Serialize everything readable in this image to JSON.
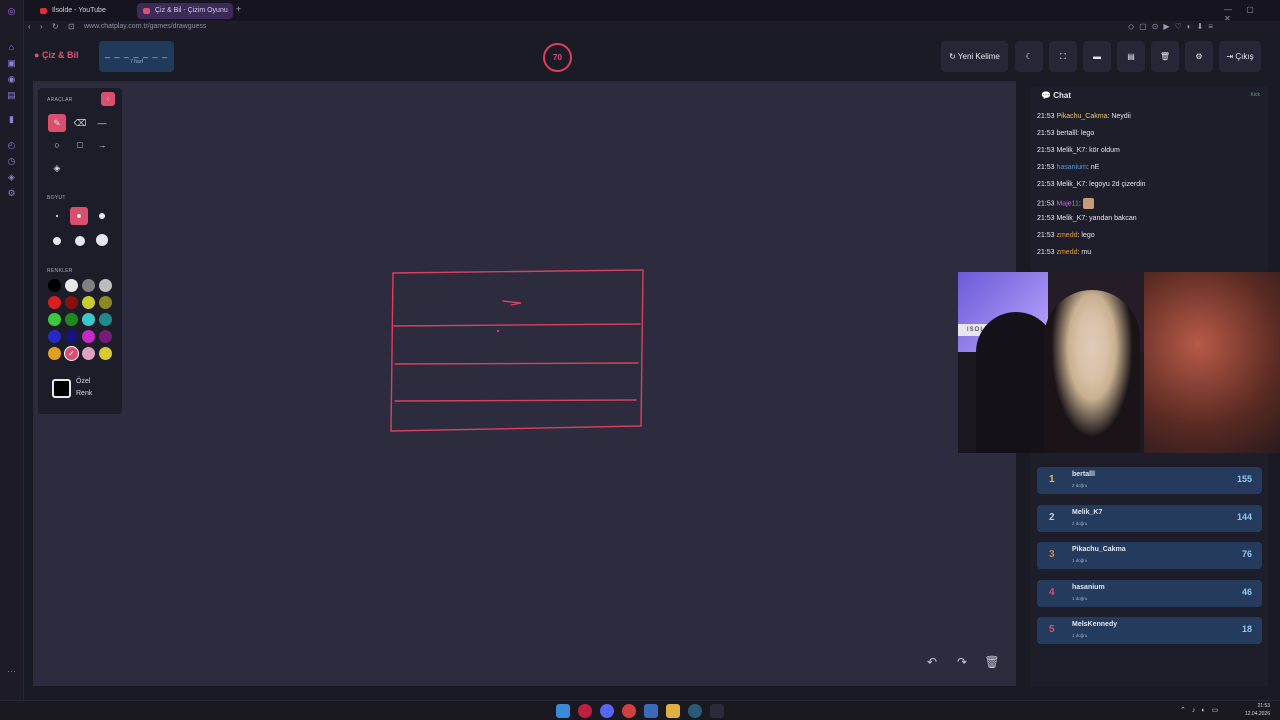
{
  "browser": {
    "tabs": [
      {
        "label": "Ilsolde - YouTube",
        "active": false
      },
      {
        "label": "Çiz & Bil - Çizim Oyunu",
        "active": true
      }
    ],
    "new_tab": "+",
    "url": "www.chatplay.com.tr/games/drawguess"
  },
  "header": {
    "logo": "Çiz & Bil",
    "word_mask": "_ _ _ _ _ _ _",
    "word_length": "7 harf",
    "timer": "70",
    "buttons": {
      "new_word": "Yeni Kelime",
      "exit": "Çıkış"
    }
  },
  "tools": {
    "section_tools": "ARAÇLAR",
    "section_size": "BOYUT",
    "section_colors": "RENKLER",
    "custom_color": "Özel Renk",
    "active_tool": "pencil",
    "active_size": 2,
    "colors": [
      "#000000",
      "#e6e6e6",
      "#808080",
      "#bdbdbd",
      "#d92020",
      "#8a1010",
      "#c9cc30",
      "#8a8a20",
      "#3cc83c",
      "#1e8a1e",
      "#3cc8c8",
      "#1e8a8a",
      "#2828c8",
      "#14147a",
      "#c828c8",
      "#7a1a7a",
      "#e0a020",
      "#d9506f",
      "#e0a0c0",
      "#d9c830"
    ],
    "selected_color_index": 17
  },
  "chat": {
    "title": "Chat",
    "status": "Kick",
    "messages": [
      {
        "time": "21:53",
        "user": "Pikachu_Cakma",
        "color": "#e8c870",
        "text": "Neydii"
      },
      {
        "time": "21:53",
        "user": "bertalll",
        "color": "#e6e6ee",
        "text": "lego"
      },
      {
        "time": "21:53",
        "user": "Melik_K7",
        "color": "#e6e6ee",
        "text": "kör oldum"
      },
      {
        "time": "21:53",
        "user": "hasanium",
        "color": "#4a9ee8",
        "text": "nE"
      },
      {
        "time": "21:53",
        "user": "Melik_K7",
        "color": "#e6e6ee",
        "text": "legoyu 2d çizerdin"
      },
      {
        "time": "21:53",
        "user": "Maje11",
        "color": "#c070e0",
        "text": ""
      },
      {
        "time": "21:53",
        "user": "Melik_K7",
        "color": "#e6e6ee",
        "text": "yandan bakcan"
      },
      {
        "time": "21:53",
        "user": "zmedd",
        "color": "#e89a3c",
        "text": "lego"
      },
      {
        "time": "21:53",
        "user": "zmedd",
        "color": "#e89a3c",
        "text": "mu"
      }
    ]
  },
  "webcam": {
    "overlay_text": "ISOLDE"
  },
  "leaderboard": [
    {
      "rank": "1",
      "name": "bertalll",
      "sub": "2 doğru",
      "score": "155",
      "rank_color": "#e0c040"
    },
    {
      "rank": "2",
      "name": "Melik_K7",
      "sub": "2 doğru",
      "score": "144",
      "rank_color": "#c8c8d6"
    },
    {
      "rank": "3",
      "name": "Pikachu_Cakma",
      "sub": "1 doğru",
      "score": "76",
      "rank_color": "#d08840"
    },
    {
      "rank": "4",
      "name": "hasanium",
      "sub": "1 doğru",
      "score": "46",
      "rank_color": "#d9506f"
    },
    {
      "rank": "5",
      "name": "MelsKennedy",
      "sub": "1 doğru",
      "score": "18",
      "rank_color": "#d9506f"
    }
  ],
  "taskbar": {
    "time": "21:53",
    "date": "12.04.2026"
  },
  "theme": {
    "accent": "#d9506f",
    "stroke": "#d9405f"
  }
}
